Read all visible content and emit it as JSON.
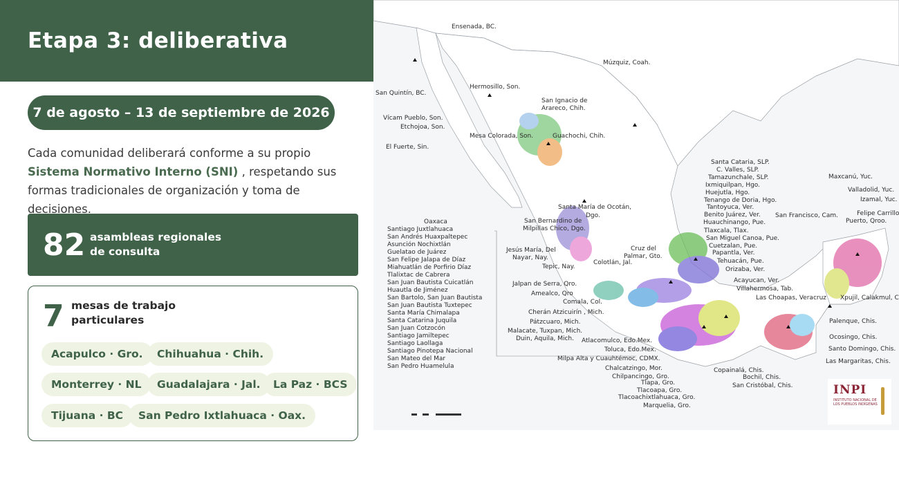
{
  "header": {
    "title": "Etapa 3: deliberativa"
  },
  "date_range": "7 de agosto – 13 de septiembre de 2026",
  "description": {
    "part1": "Cada comunidad deliberará conforme a su propio ",
    "highlight": "Sistema Normativo Interno (SNI)",
    "part2": " , respetando sus formas tradicionales de organización y toma de decisiones."
  },
  "assemblies": {
    "count": "82",
    "label_line1": "asambleas regionales",
    "label_line2": "de consulta"
  },
  "tables": {
    "count": "7",
    "label_line1": "mesas de trabajo",
    "label_line2": "particulares",
    "cities": [
      "Acapulco · Gro.",
      "Chihuahua · Chih.",
      "Monterrey · NL",
      "Guadalajara · Jal.",
      "La Paz · BCS",
      "Tijuana · BC",
      "San Pedro Ixtlahuaca · Oax."
    ]
  },
  "map": {
    "labels": [
      "Ensenada, BC.",
      "San Quintín, BC.",
      "Hermosillo, Son.",
      "Múzquiz, Coah.",
      "San Ignacio de",
      "Arareco, Chih.",
      "Vícam Pueblo, Son.",
      "Etchojoa, Son.",
      "Mesa Colorada, Son.",
      "Guachochi, Chih.",
      "El Fuerte, Sin.",
      "Santa Cataria, SLP.",
      "C. Valles, SLP.",
      "Tamazunchale, SLP.",
      "Ixmiquilpan, Hgo.",
      "Huejutla, Hgo.",
      "Tenango de Doria, Hgo.",
      "Tantoyuca, Ver.",
      "Maxcanú, Yuc.",
      "Valladolid, Yuc.",
      "Izamal, Yuc.",
      "Santa María de Ocotán,",
      "Dgo.",
      "San Bernardino de",
      "Milpillas Chico, Dgo.",
      "Benito Juárez, Ver.",
      "Huauchinango, Pue.",
      "San Francisco, Cam.",
      "Felipe Carrillo",
      "Puerto, Qroo.",
      "Tlaxcala, Tlax.",
      "San Miguel Canoa, Pue.",
      "Cuetzalan, Pue.",
      "Papantla, Ver.",
      "Tehuacán, Pue.",
      "Orizaba, Ver.",
      "Jesús María, Del",
      "Nayar, Nay.",
      "Tepic, Nay.",
      "Cruz del",
      "Palmar, Gto.",
      "Colotlán, Jal.",
      "Acayucan, Ver.",
      "Villahermosa, Tab.",
      "Las Choapas, Veracruz",
      "Xpujil, Calakmul, Cam.",
      "Jalpan de Serra, Qro.",
      "Amealco, Qro",
      "Comala, Col.",
      "Cherán Atzicuirín , Mich.",
      "Pátzcuaro, Mich.",
      "Malacate, Tuxpan, Mich.",
      "Duin, Aquila, Mich.",
      "Atlacomulco, Edo.Mex.",
      "Toluca, Edo.Mex.",
      "Milpa Alta y Cuauhtémoc, CDMX.",
      "Chalcatzingo, Mor.",
      "Chilpancingo, Gro.",
      "Tlapa, Gro.",
      "Tlacoapa, Gro.",
      "Tlacoachixtlahuaca, Gro.",
      "Marquelia, Gro.",
      "Copainalá, Chis.",
      "Bochil, Chis.",
      "San Cristóbal, Chis.",
      "Palenque, Chis.",
      "Ocosingo, Chis.",
      "Santo Domingo, Chis.",
      "Las Margaritas, Chis.",
      "Oaxaca",
      "Santiago Juxtlahuaca",
      "San Andrés Huaxpaltepec",
      "Asunción Nochixtlán",
      "Guelatao de Juárez",
      "San Felipe Jalapa de Díaz",
      "Miahuatlán de Porfirio Díaz",
      "Tlalixtac de Cabrera",
      "San Juan Bautista Cuicatlán",
      "Huautla de Jiménez",
      "San Bartolo, San Juan Bautista",
      "San Juan Bautista Tuxtepec",
      "Santa María Chimalapa",
      "Santa Catarina Juquila",
      "San Juan Cotzocón",
      "Santiago Jamiltepec",
      "Santiago Laollaga",
      "Santiago Pinotepa Nacional",
      "San Mateo del Mar",
      "San Pedro Huamelula"
    ]
  },
  "logo": {
    "name": "INPI",
    "subtitle": "INSTITUTO NACIONAL DE LOS PUEBLOS INDÍGENAS"
  },
  "colors": {
    "primary_green": "#3f6249",
    "chip_bg": "#eef3e3",
    "logo_red": "#8b2535"
  }
}
